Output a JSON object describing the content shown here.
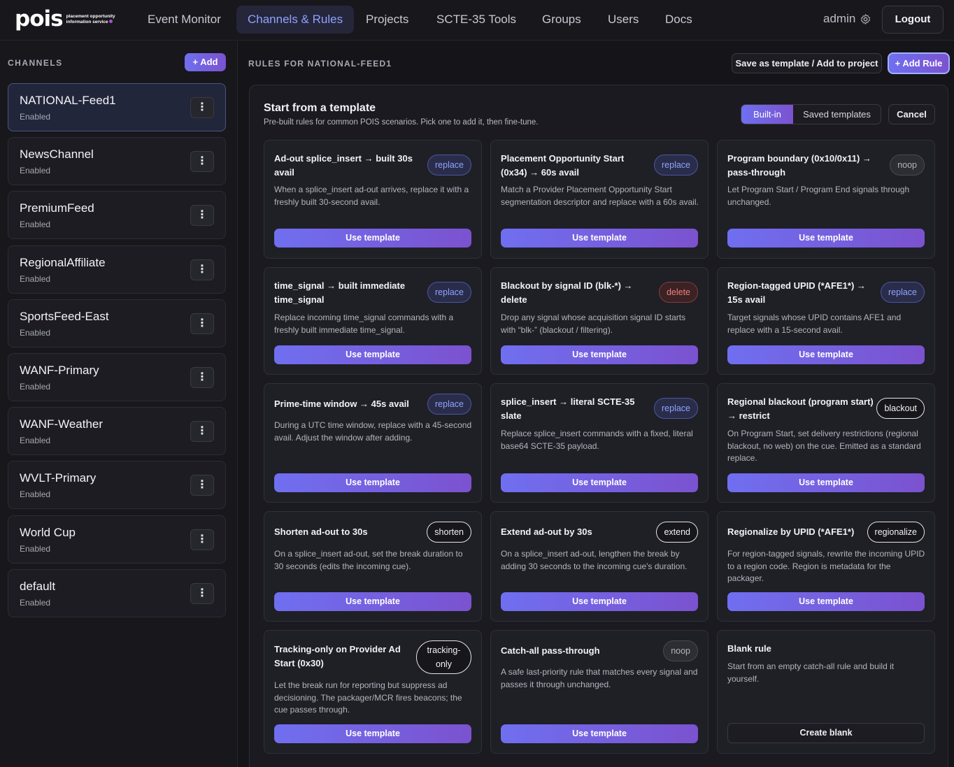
{
  "logo": {
    "word": "pois",
    "sub_line1": "placement opportunity",
    "sub_line2": "information service"
  },
  "nav": [
    {
      "label": "Event Monitor"
    },
    {
      "label": "Channels & Rules"
    },
    {
      "label": "Projects"
    },
    {
      "label": "SCTE-35 Tools"
    },
    {
      "label": "Groups"
    },
    {
      "label": "Users"
    },
    {
      "label": "Docs"
    }
  ],
  "user": {
    "name": "admin",
    "logout": "Logout"
  },
  "sidebar": {
    "title": "CHANNELS",
    "add_label": "+ Add",
    "channels": [
      {
        "name": "NATIONAL-Feed1",
        "status": "Enabled"
      },
      {
        "name": "NewsChannel",
        "status": "Enabled"
      },
      {
        "name": "PremiumFeed",
        "status": "Enabled"
      },
      {
        "name": "RegionalAffiliate",
        "status": "Enabled"
      },
      {
        "name": "SportsFeed-East",
        "status": "Enabled"
      },
      {
        "name": "WANF-Primary",
        "status": "Enabled"
      },
      {
        "name": "WANF-Weather",
        "status": "Enabled"
      },
      {
        "name": "WVLT-Primary",
        "status": "Enabled"
      },
      {
        "name": "World Cup",
        "status": "Enabled"
      },
      {
        "name": "default",
        "status": "Enabled"
      }
    ],
    "menu_glyph": "⋮"
  },
  "main": {
    "rules_title": "RULES FOR NATIONAL-FEED1",
    "save_template": "Save as template / Add to project",
    "add_rule": "+ Add Rule"
  },
  "templates": {
    "title": "Start from a template",
    "subtitle": "Pre-built rules for common POIS scenarios. Pick one to add it, then fine-tune.",
    "tab_builtin": "Built-in",
    "tab_saved": "Saved templates",
    "cancel": "Cancel",
    "use_label": "Use template",
    "cards": [
      {
        "title": "Ad-out splice_insert → built 30s avail",
        "badge": "replace",
        "desc": "When a splice_insert ad-out arrives, replace it with a freshly built 30-second avail."
      },
      {
        "title": "Placement Opportunity Start (0x34) → 60s avail",
        "badge": "replace",
        "desc": "Match a Provider Placement Opportunity Start segmentation descriptor and replace with a 60s avail."
      },
      {
        "title": "Program boundary (0x10/0x11) → pass-through",
        "badge": "noop",
        "desc": "Let Program Start / Program End signals through unchanged."
      },
      {
        "title": "time_signal → built immediate time_signal",
        "badge": "replace",
        "desc": "Replace incoming time_signal commands with a freshly built immediate time_signal."
      },
      {
        "title": "Blackout by signal ID (blk-*) → delete",
        "badge": "delete",
        "desc": "Drop any signal whose acquisition signal ID starts with “blk-” (blackout / filtering)."
      },
      {
        "title": "Region-tagged UPID (*AFE1*) → 15s avail",
        "badge": "replace",
        "desc": "Target signals whose UPID contains AFE1 and replace with a 15-second avail."
      },
      {
        "title": "Prime-time window → 45s avail",
        "badge": "replace",
        "desc": "During a UTC time window, replace with a 45-second avail. Adjust the window after adding."
      },
      {
        "title": "splice_insert → literal SCTE-35 slate",
        "badge": "replace",
        "desc": "Replace splice_insert commands with a fixed, literal base64 SCTE-35 payload."
      },
      {
        "title": "Regional blackout (program start) → restrict",
        "badge": "blackout",
        "desc": "On Program Start, set delivery restrictions (regional blackout, no web) on the cue. Emitted as a standard replace."
      },
      {
        "title": "Shorten ad-out to 30s",
        "badge": "shorten",
        "desc": "On a splice_insert ad-out, set the break duration to 30 seconds (edits the incoming cue)."
      },
      {
        "title": "Extend ad-out by 30s",
        "badge": "extend",
        "desc": "On a splice_insert ad-out, lengthen the break by adding 30 seconds to the incoming cue's duration."
      },
      {
        "title": "Regionalize by UPID (*AFE1*)",
        "badge": "regionalize",
        "desc": "For region-tagged signals, rewrite the incoming UPID to a region code. Region is metadata for the packager."
      },
      {
        "title": "Tracking-only on Provider Ad Start (0x30)",
        "badge": "tracking-only",
        "desc": "Let the break run for reporting but suppress ad decisioning. The packager/MCR fires beacons; the cue passes through."
      },
      {
        "title": "Catch-all pass-through",
        "badge": "noop",
        "desc": "A safe last-priority rule that matches every signal and passes it through unchanged."
      },
      {
        "title": "Blank rule",
        "badge": "",
        "desc": "Start from an empty catch-all rule and build it yourself."
      }
    ],
    "blank_button": "Create blank"
  }
}
